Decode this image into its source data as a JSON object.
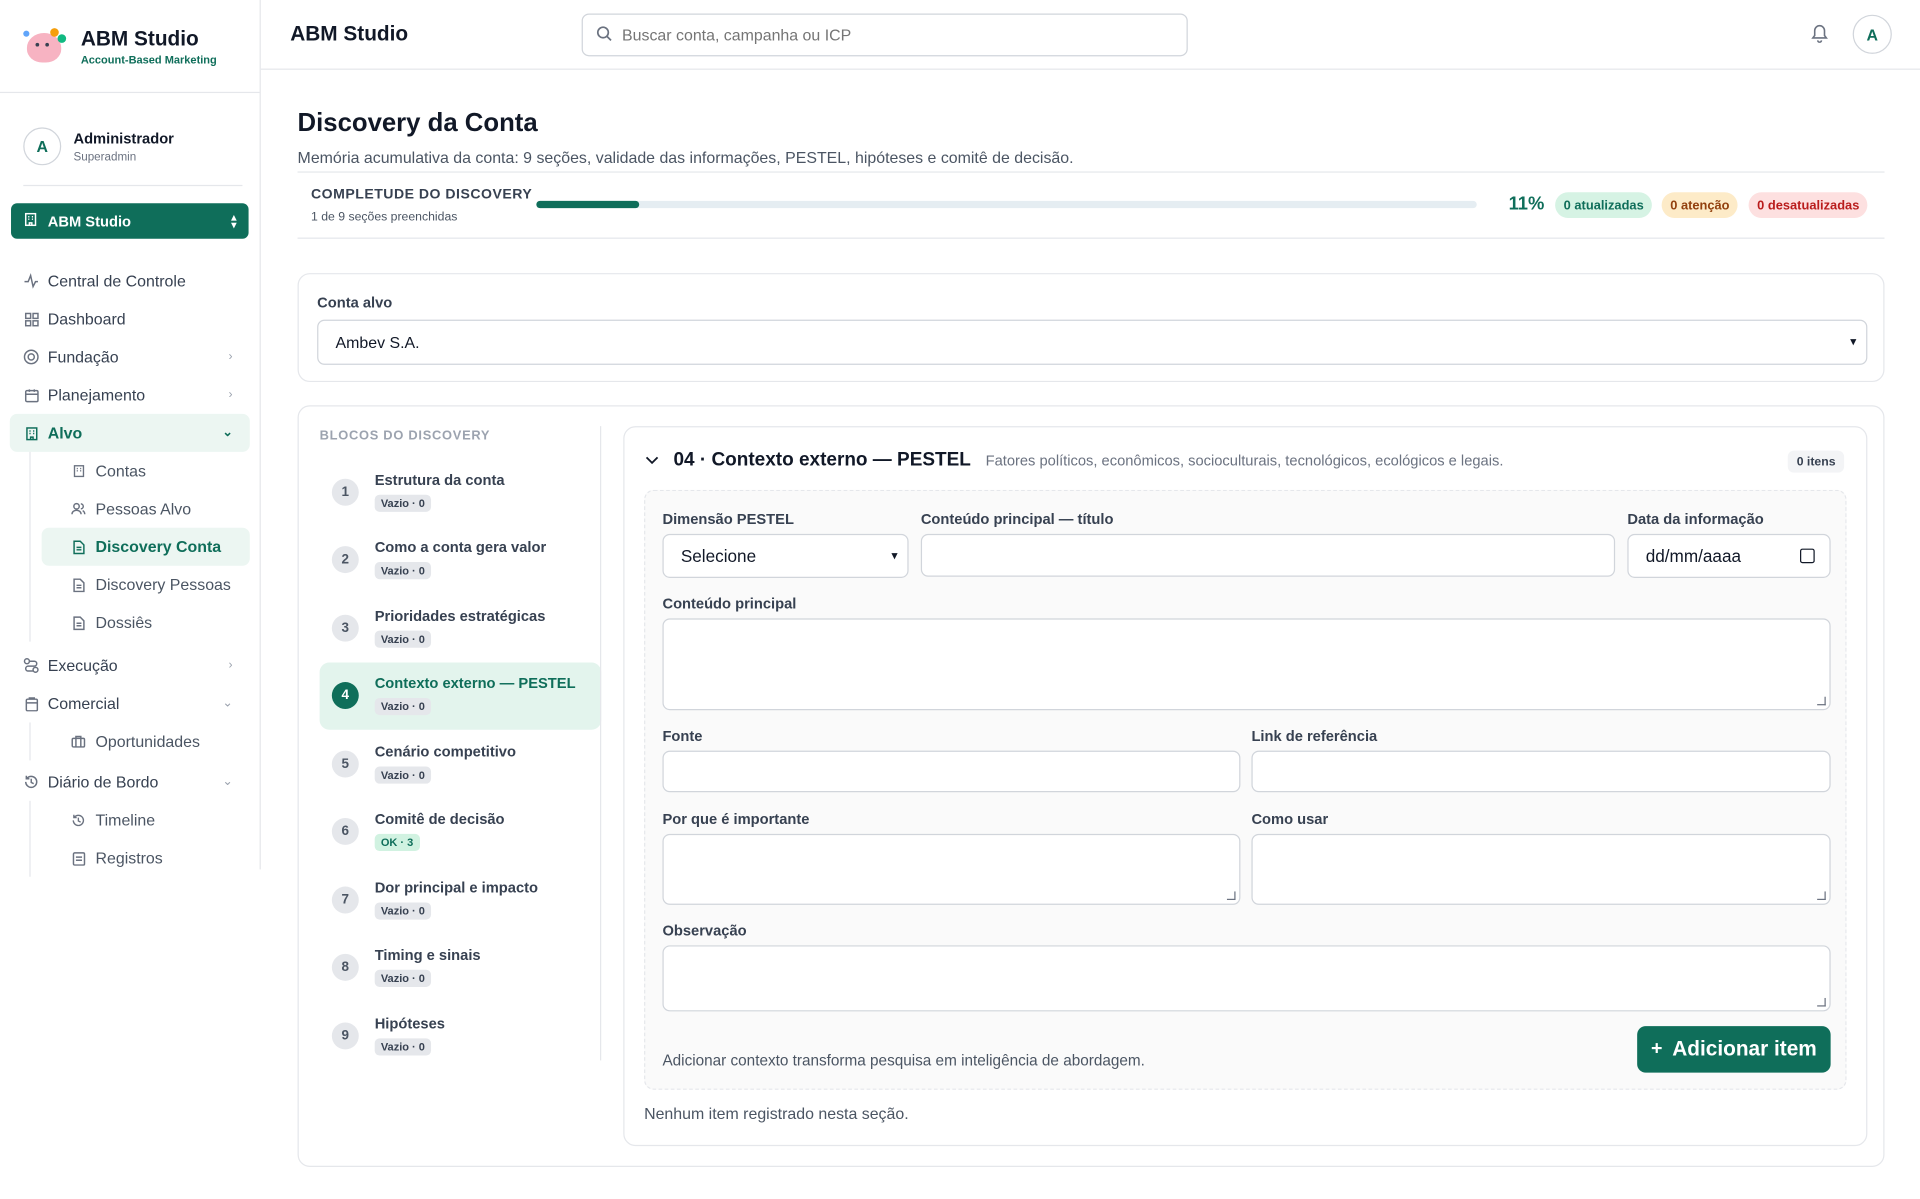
{
  "brand": {
    "title": "ABM Studio",
    "subtitle": "Account-Based Marketing"
  },
  "user": {
    "initial": "A",
    "name": "Administrador",
    "role": "Superadmin"
  },
  "workspace": {
    "label": "ABM Studio"
  },
  "nav": {
    "central": "Central de Controle",
    "dashboard": "Dashboard",
    "fundacao": "Fundação",
    "planejamento": "Planejamento",
    "alvo": "Alvo",
    "alvo_items": [
      "Contas",
      "Pessoas Alvo",
      "Discovery Conta",
      "Discovery Pessoas",
      "Dossiês"
    ],
    "execucao": "Execução",
    "comercial": "Comercial",
    "comercial_items": [
      "Oportunidades"
    ],
    "diario": "Diário de Bordo",
    "diario_items": [
      "Timeline",
      "Registros"
    ]
  },
  "topbar": {
    "title": "ABM Studio",
    "search_placeholder": "Buscar conta, campanha ou ICP",
    "avatar": "A"
  },
  "page": {
    "title": "Discovery da Conta",
    "subtitle": "Memória acumulativa da conta: 9 seções, validade das informações, PESTEL, hipóteses e comitê de decisão."
  },
  "completeness": {
    "label": "COMPLETUDE DO DISCOVERY",
    "sub": "1 de 9 seções preenchidas",
    "progress": 0.11,
    "pct": "11%",
    "badges": {
      "updated": "0 atualizadas",
      "attention": "0 atenção",
      "outdated": "0 desatualizadas"
    }
  },
  "account": {
    "label": "Conta alvo",
    "value": "Ambev S.A."
  },
  "blocks": {
    "header": "BLOCOS DO DISCOVERY",
    "items": [
      {
        "n": "1",
        "title": "Estrutura da conta",
        "status": "Vazio · 0"
      },
      {
        "n": "2",
        "title": "Como a conta gera valor",
        "status": "Vazio · 0"
      },
      {
        "n": "3",
        "title": "Prioridades estratégicas",
        "status": "Vazio · 0"
      },
      {
        "n": "4",
        "title": "Contexto externo — PESTEL",
        "status": "Vazio · 0"
      },
      {
        "n": "5",
        "title": "Cenário competitivo",
        "status": "Vazio · 0"
      },
      {
        "n": "6",
        "title": "Comitê de decisão",
        "status": "OK · 3"
      },
      {
        "n": "7",
        "title": "Dor principal e impacto",
        "status": "Vazio · 0"
      },
      {
        "n": "8",
        "title": "Timing e sinais",
        "status": "Vazio · 0"
      },
      {
        "n": "9",
        "title": "Hipóteses",
        "status": "Vazio · 0"
      }
    ]
  },
  "section": {
    "title": "04 · Contexto externo — PESTEL",
    "desc": "Fatores políticos, econômicos, socioculturais, tecnológicos, ecológicos e legais.",
    "count": "0 itens"
  },
  "form": {
    "dim_label": "Dimensão PESTEL",
    "dim_value": "Selecione",
    "title_label": "Conteúdo principal — título",
    "date_label": "Data da informação",
    "date_placeholder": "dd/mm/aaaa",
    "content_label": "Conteúdo principal",
    "source_label": "Fonte",
    "link_label": "Link de referência",
    "why_label": "Por que é importante",
    "how_label": "Como usar",
    "obs_label": "Observação",
    "hint": "Adicionar contexto transforma pesquisa em inteligência de abordagem.",
    "add_label": "Adicionar item"
  },
  "empty": "Nenhum item registrado nesta seção.",
  "colors": {
    "primary": "#0f6e5a",
    "accent_bg": "#ecf6f2",
    "updated_bg": "#d6f3e4",
    "attention_bg": "#fdebc8",
    "outdated_bg": "#fde0e0"
  }
}
